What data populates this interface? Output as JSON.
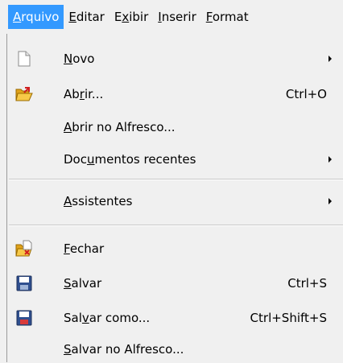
{
  "menubar": [
    {
      "pre": "",
      "mn": "A",
      "post": "rquivo",
      "active": true
    },
    {
      "pre": "",
      "mn": "E",
      "post": "ditar",
      "active": false
    },
    {
      "pre": "E",
      "mn": "x",
      "post": "ibir",
      "active": false
    },
    {
      "pre": "",
      "mn": "I",
      "post": "nserir",
      "active": false
    },
    {
      "pre": "",
      "mn": "F",
      "post": "ormat",
      "active": false
    }
  ],
  "menu": {
    "items": [
      {
        "pre": "",
        "mn": "N",
        "post": "ovo",
        "shortcut": "",
        "icon": "new-document-icon",
        "submenu": true
      },
      {
        "pre": "Ab",
        "mn": "r",
        "post": "ir...",
        "shortcut": "Ctrl+O",
        "icon": "open-folder-icon",
        "submenu": false
      },
      {
        "pre": "",
        "mn": "A",
        "post": "brir no Alfresco...",
        "shortcut": "",
        "icon": "",
        "submenu": false
      },
      {
        "pre": "Doc",
        "mn": "u",
        "post": "mentos recentes",
        "shortcut": "",
        "icon": "",
        "submenu": true
      },
      {
        "pre": "",
        "mn": "A",
        "post": "ssistentes",
        "shortcut": "",
        "icon": "",
        "submenu": true
      },
      {
        "pre": "",
        "mn": "F",
        "post": "echar",
        "shortcut": "",
        "icon": "close-document-icon",
        "submenu": false
      },
      {
        "pre": "",
        "mn": "S",
        "post": "alvar",
        "shortcut": "Ctrl+S",
        "icon": "save-icon",
        "submenu": false
      },
      {
        "pre": "Sal",
        "mn": "v",
        "post": "ar como...",
        "shortcut": "Ctrl+Shift+S",
        "icon": "save-as-icon",
        "submenu": false
      },
      {
        "pre": "",
        "mn": "S",
        "post": "alvar no Alfresco...",
        "shortcut": "",
        "icon": "",
        "submenu": false
      }
    ]
  }
}
